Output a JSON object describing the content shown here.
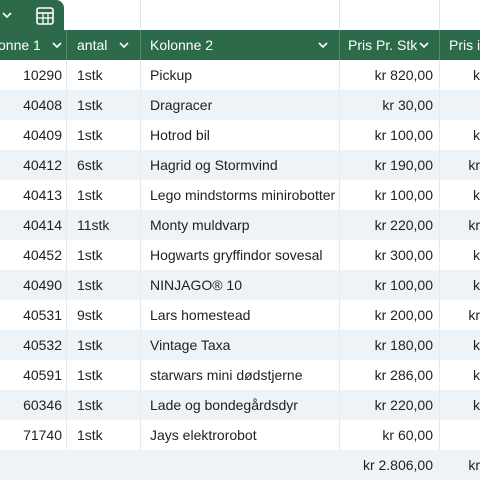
{
  "header": {
    "col1": "onne 1",
    "col2": "antal",
    "col3": "Kolonne 2",
    "col4": "Pris Pr. Stk",
    "col5": "Pris i"
  },
  "rows": [
    {
      "id": "10290",
      "antal": "1stk",
      "navn": "Pickup",
      "pris": "kr 820,00",
      "pris_total": "k"
    },
    {
      "id": "40408",
      "antal": "1stk",
      "navn": "Dragracer",
      "pris": "kr 30,00",
      "pris_total": ""
    },
    {
      "id": "40409",
      "antal": "1stk",
      "navn": "Hotrod bil",
      "pris": "kr 100,00",
      "pris_total": "k"
    },
    {
      "id": "40412",
      "antal": "6stk",
      "navn": "Hagrid og Stormvind",
      "pris": "kr 190,00",
      "pris_total": "kr"
    },
    {
      "id": "40413",
      "antal": "1stk",
      "navn": "Lego mindstorms minirobotter",
      "pris": "kr 100,00",
      "pris_total": "k"
    },
    {
      "id": "40414",
      "antal": "11stk",
      "navn": "Monty muldvarp",
      "pris": "kr 220,00",
      "pris_total": "kr"
    },
    {
      "id": "40452",
      "antal": "1stk",
      "navn": "Hogwarts gryffindor sovesal",
      "pris": "kr 300,00",
      "pris_total": "k"
    },
    {
      "id": "40490",
      "antal": "1stk",
      "navn": "NINJAGO® 10",
      "pris": "kr 100,00",
      "pris_total": "k"
    },
    {
      "id": "40531",
      "antal": "9stk",
      "navn": "Lars homestead",
      "pris": "kr 200,00",
      "pris_total": "kr"
    },
    {
      "id": "40532",
      "antal": "1stk",
      "navn": "Vintage Taxa",
      "pris": "kr 180,00",
      "pris_total": "k"
    },
    {
      "id": "40591",
      "antal": "1stk",
      "navn": "starwars mini dødstjerne",
      "pris": "kr 286,00",
      "pris_total": "k"
    },
    {
      "id": "60346",
      "antal": "1stk",
      "navn": "Lade og bondegårdsdyr",
      "pris": "kr 220,00",
      "pris_total": "k"
    },
    {
      "id": "71740",
      "antal": "1stk",
      "navn": "Jays elektrorobot",
      "pris": "kr 60,00",
      "pris_total": ""
    }
  ],
  "total": {
    "pris": "kr 2.806,00",
    "pris_total": "kr"
  },
  "icons": {
    "tab_dropdown": "chevron-down-icon",
    "sheet": "table-sheet-icon",
    "header_filter": "chevron-down-icon"
  },
  "colors": {
    "header_bg": "#2d6a4a",
    "band_row": "#eef3f8"
  }
}
